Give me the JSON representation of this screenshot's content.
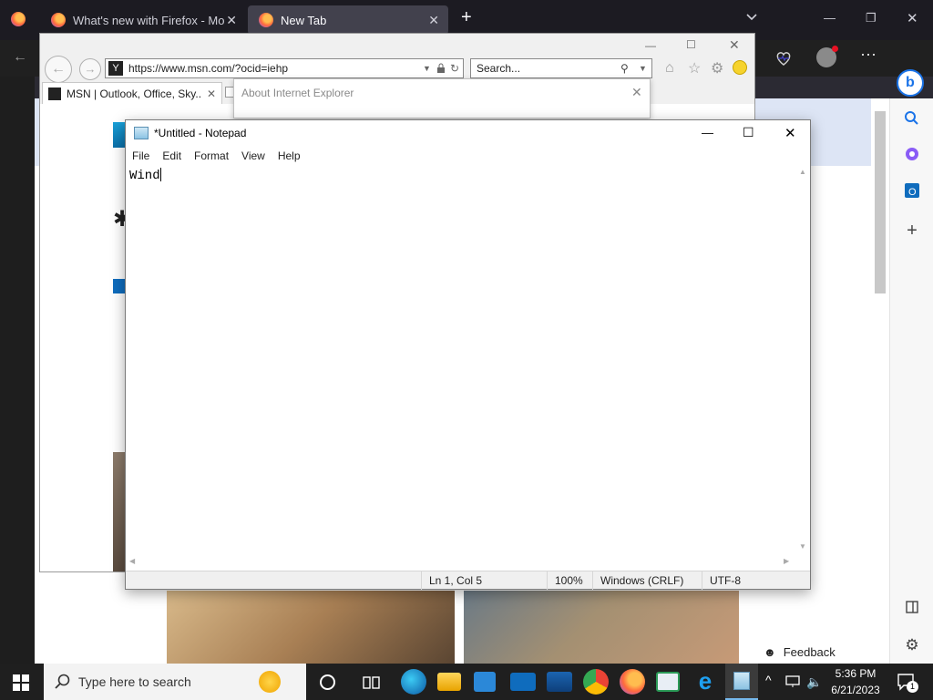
{
  "firefox": {
    "tabs": [
      {
        "label": "What's new with Firefox - More"
      },
      {
        "label": "New Tab"
      }
    ],
    "new_tab_symbol": "+"
  },
  "ie": {
    "url": "https://www.msn.com/?ocid=iehp",
    "search_placeholder": "Search...",
    "tab_label": "MSN | Outlook, Office, Sky...",
    "about_title": "About Internet Explorer"
  },
  "edge": {
    "feedback_label": "Feedback"
  },
  "notepad": {
    "title": "*Untitled - Notepad",
    "menu": [
      "File",
      "Edit",
      "Format",
      "View",
      "Help"
    ],
    "content": "Wind",
    "status": {
      "position": "Ln 1, Col 5",
      "zoom": "100%",
      "line_ending": "Windows (CRLF)",
      "encoding": "UTF-8"
    }
  },
  "taskbar": {
    "search_placeholder": "Type here to search",
    "time": "5:36 PM",
    "date": "6/21/2023",
    "notification_count": "1"
  },
  "colors": {
    "firefox_bg": "#1c1b22",
    "taskbar_bg": "#1f1f1f",
    "edge_accent": "#0078d4"
  }
}
